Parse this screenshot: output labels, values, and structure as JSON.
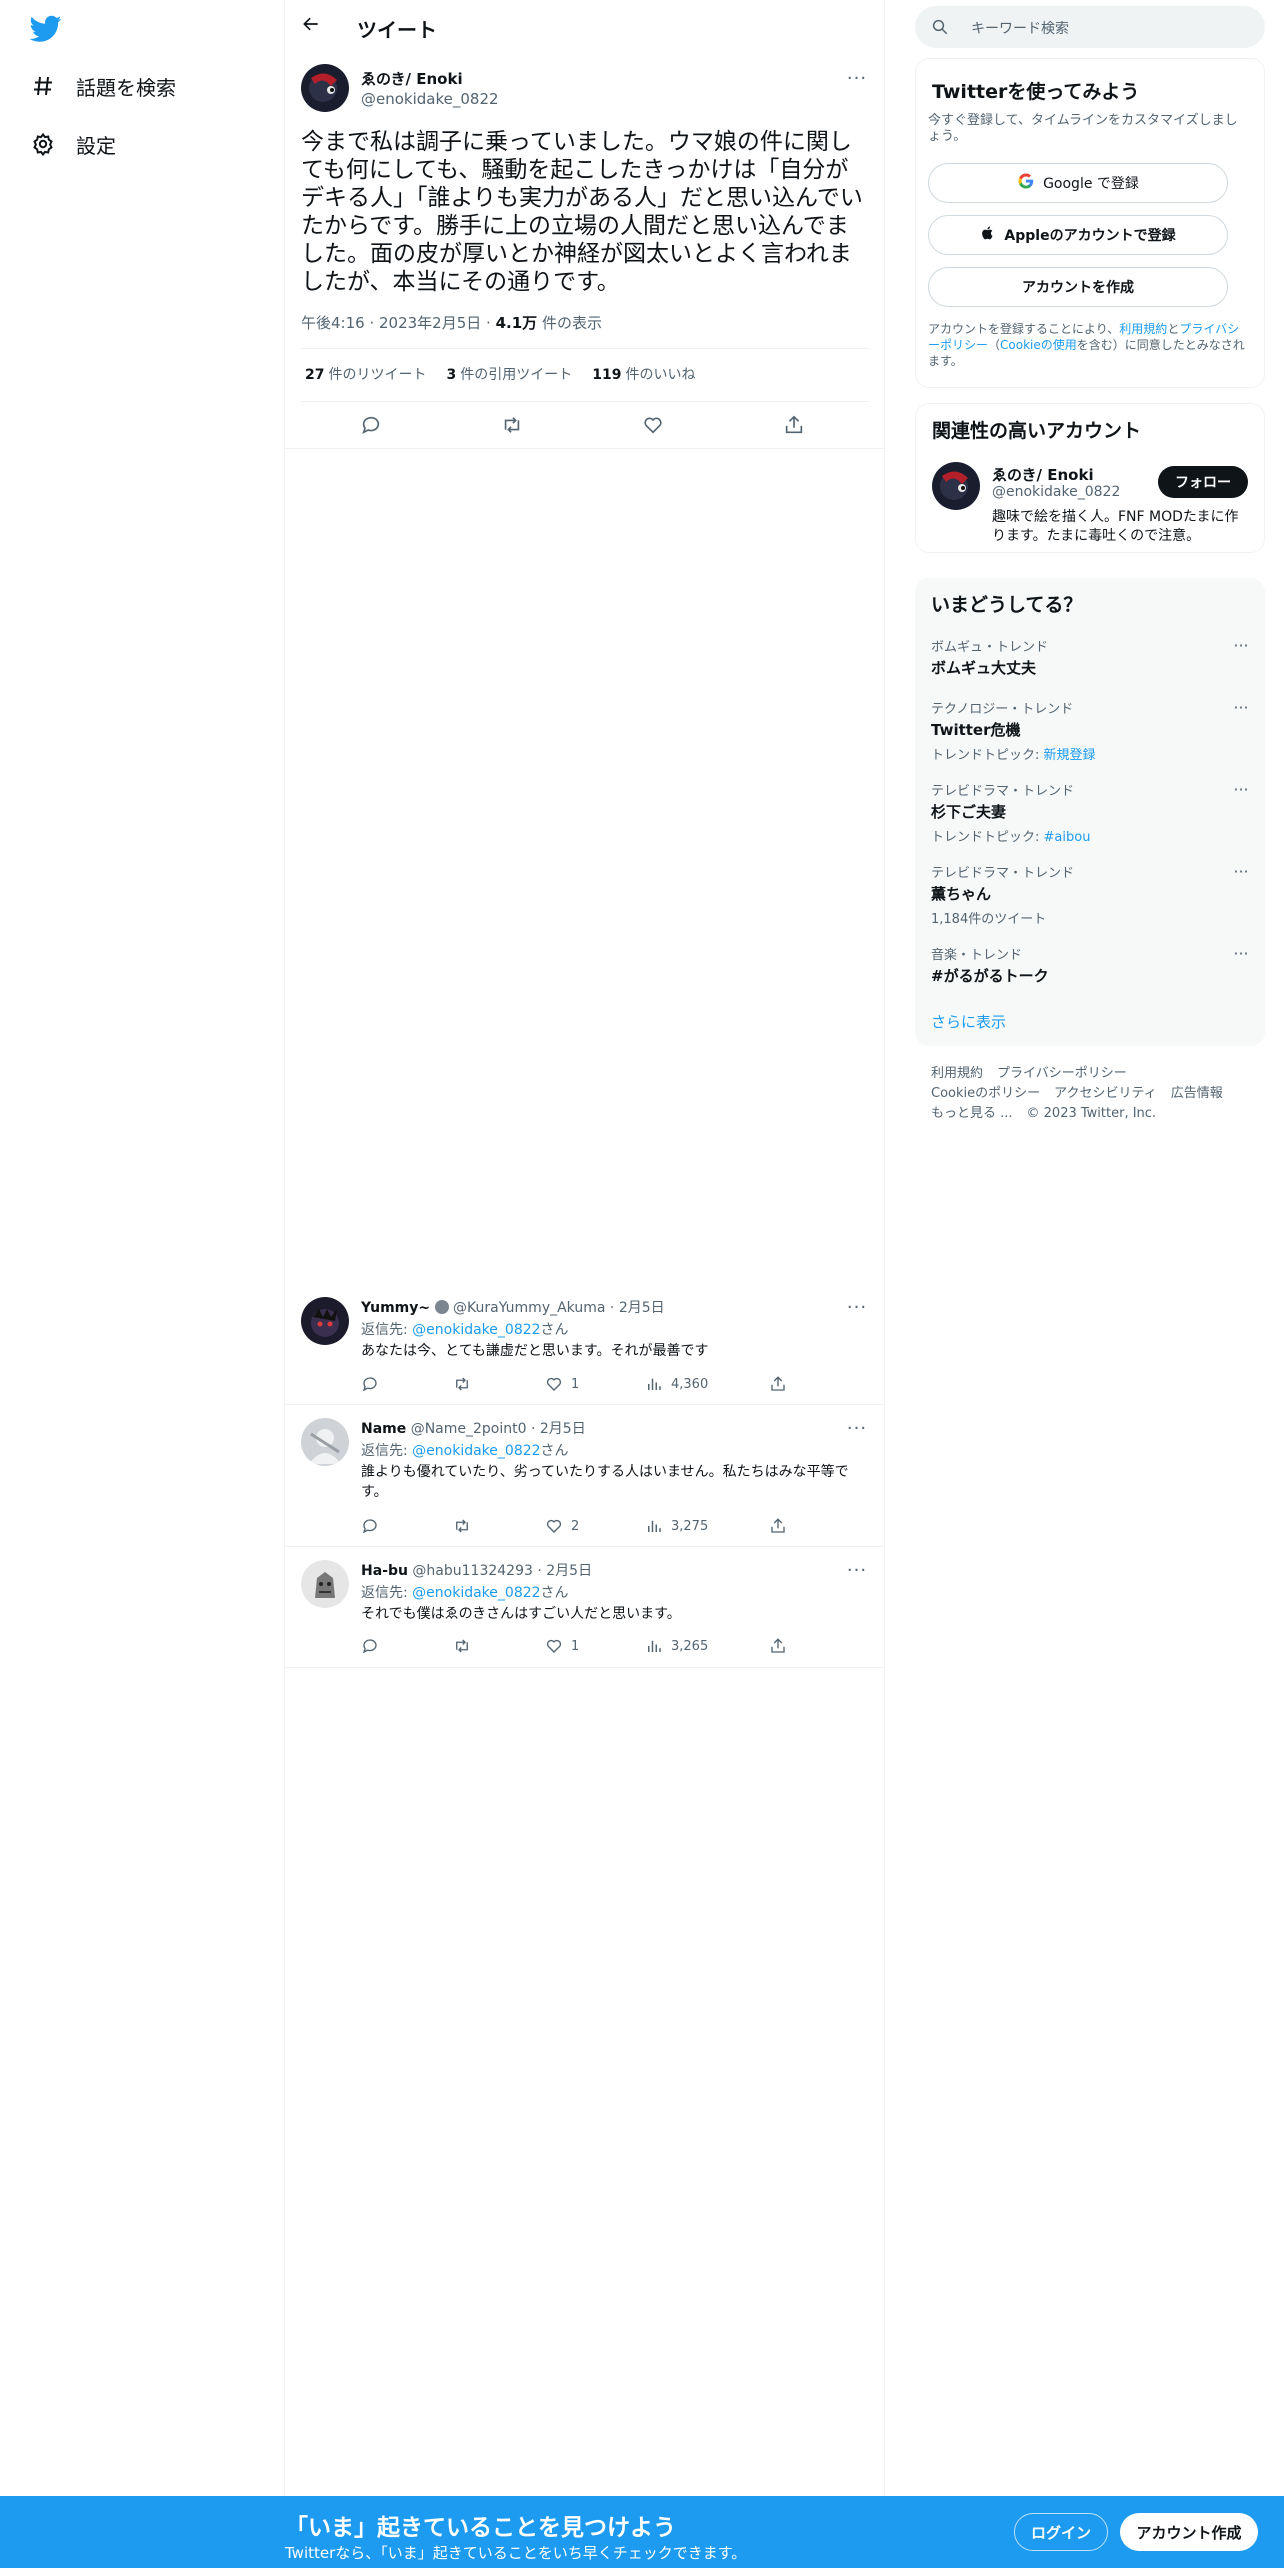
{
  "nav": {
    "items": [
      {
        "label": "話題を検索",
        "icon": "hashtag-icon"
      },
      {
        "label": "設定",
        "icon": "gear-icon"
      }
    ]
  },
  "header": {
    "title": "ツイート"
  },
  "tweet": {
    "author_name": "ゑのき/ Enoki",
    "author_handle": "@enokidake_0822",
    "text": "今まで私は調子に乗っていました。ウマ娘の件に関しても何にしても、騒動を起こしたきっかけは「自分がデキる人」「誰よりも実力がある人」だと思い込んでいたからです。勝手に上の立場の人間だと思い込んでました。面の皮が厚いとか神経が図太いとよく言われましたが、本当にその通りです。",
    "time": "午後4:16",
    "date": "2023年2月5日",
    "views_count": "4.1万",
    "views_label": "件の表示",
    "retweets_count": "27",
    "retweets_label": "件のリツイート",
    "quotes_count": "3",
    "quotes_label": "件の引用ツイート",
    "likes_count": "119",
    "likes_label": "件のいいね"
  },
  "replies": [
    {
      "name": "Yummy~",
      "handle": "@KuraYummy_Akuma",
      "date": "2月5日",
      "reply_prefix": "返信先: ",
      "reply_to": "@enokidake_0822",
      "reply_suffix": "さん",
      "text": "あなたは今、とても謙虚だと思います。それが最善です",
      "likes": "1",
      "views": "4,360"
    },
    {
      "name": "Name",
      "handle": "@Name_2point0",
      "date": "2月5日",
      "reply_prefix": "返信先: ",
      "reply_to": "@enokidake_0822",
      "reply_suffix": "さん",
      "text": "誰よりも優れていたり、劣っていたりする人はいません。私たちはみな平等です。",
      "likes": "2",
      "views": "3,275"
    },
    {
      "name": "Ha-bu",
      "handle": "@habu11324293",
      "date": "2月5日",
      "reply_prefix": "返信先: ",
      "reply_to": "@enokidake_0822",
      "reply_suffix": "さん",
      "text": "それでも僕はゑのきさんはすごい人だと思います。",
      "likes": "1",
      "views": "3,265"
    }
  ],
  "search": {
    "placeholder": "キーワード検索"
  },
  "signup_card": {
    "title": "Twitterを使ってみよう",
    "subtitle": "今すぐ登録して、タイムラインをカスタマイズしましょう。",
    "google_label": "Google で登録",
    "apple_label": "Appleのアカウントで登録",
    "create_label": "アカウントを作成",
    "terms_prefix": "アカウントを登録することにより、",
    "terms_link": "利用規約",
    "terms_and": "と",
    "privacy_link": "プライバシーポリシー",
    "cookie_open": "（",
    "cookie_link": "Cookieの使用",
    "terms_suffix": "を含む）に同意したとみなされます。"
  },
  "related_card": {
    "title": "関連性の高いアカウント",
    "name": "ゑのき/ Enoki",
    "handle": "@enokidake_0822",
    "bio": "趣味で絵を描く人。FNF MODたまに作ります。たまに毒吐くので注意。",
    "follow_label": "フォロー"
  },
  "trends_card": {
    "title": "いまどうしてる？",
    "items": [
      {
        "category": "ボムギュ・トレンド",
        "name": "ボムギュ大丈夫",
        "sub_prefix": "",
        "sub_link": ""
      },
      {
        "category": "テクノロジー・トレンド",
        "name": "Twitter危機",
        "sub_prefix": "トレンドトピック: ",
        "sub_link": "新規登録"
      },
      {
        "category": "テレビドラマ・トレンド",
        "name": "杉下ご夫妻",
        "sub_prefix": "トレンドトピック: ",
        "sub_link": "#aibou"
      },
      {
        "category": "テレビドラマ・トレンド",
        "name": "薫ちゃん",
        "sub_prefix": "1,184件のツイート",
        "sub_link": ""
      },
      {
        "category": "音楽・トレンド",
        "name": "#がるがるトーク",
        "sub_prefix": "",
        "sub_link": ""
      }
    ],
    "show_more": "さらに表示"
  },
  "footer": {
    "links": [
      "利用規約",
      "プライバシーポリシー",
      "Cookieのポリシー",
      "アクセシビリティ",
      "広告情報",
      "もっと見る ..."
    ],
    "copyright": "© 2023 Twitter, Inc."
  },
  "banner": {
    "title": "「いま」起きていることを見つけよう",
    "subtitle": "Twitterなら、「いま」起きていることをいち早くチェックできます。",
    "login_label": "ログイン",
    "signup_label": "アカウント作成"
  },
  "colors": {
    "accent": "#1d9bf0",
    "text": "#0f1419",
    "muted": "#536471",
    "border": "#eff3f4"
  }
}
